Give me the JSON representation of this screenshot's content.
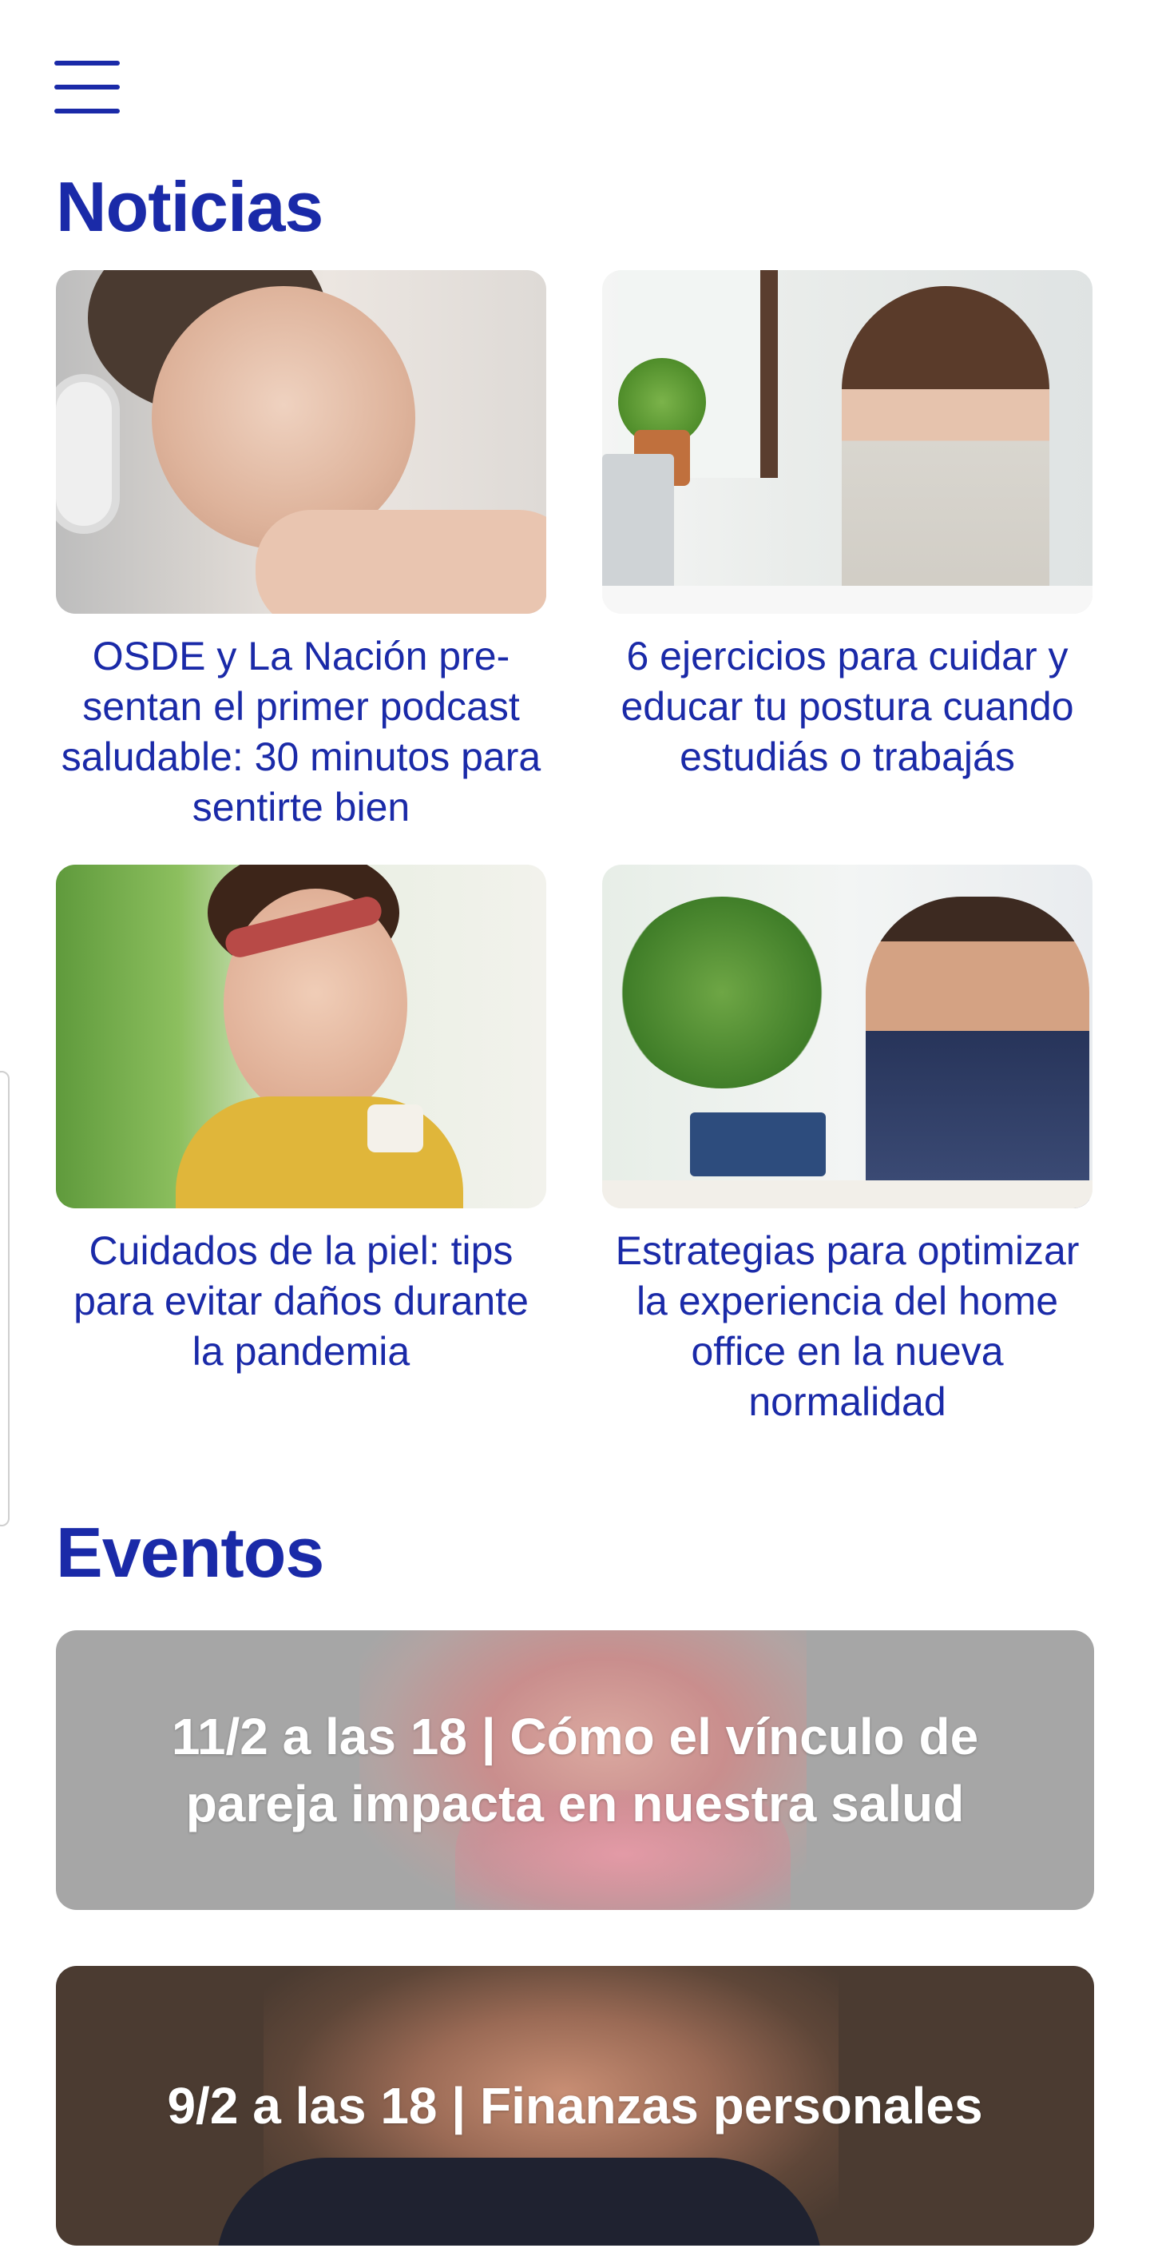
{
  "menu": {
    "icon": "hamburger-menu-icon"
  },
  "news": {
    "title": "Noticias",
    "items": [
      {
        "text": "OSDE y La Nación pre-sentan el primer podcast saludable: 30 minutos para sentirte bien"
      },
      {
        "text": "6 ejercicios para cuidar y educar tu postura cuando estudiás o trabajás"
      },
      {
        "text": "Cuidados de la piel: tips para evitar daños durante la pandemia"
      },
      {
        "text": "Estrategias para optimizar la experiencia del home office en la nueva normalidad"
      }
    ]
  },
  "events": {
    "title": "Eventos",
    "items": [
      {
        "text": "11/2 a las 18 | Cómo el vínculo de pareja impacta en nuestra salud"
      },
      {
        "text": "9/2 a las 18 | Finanzas personales"
      }
    ]
  },
  "colors": {
    "accent": "#1a2aa8",
    "background": "#ffffff",
    "event_1_bg": "#a6a6a6",
    "event_2_bg": "#4b3b31"
  }
}
